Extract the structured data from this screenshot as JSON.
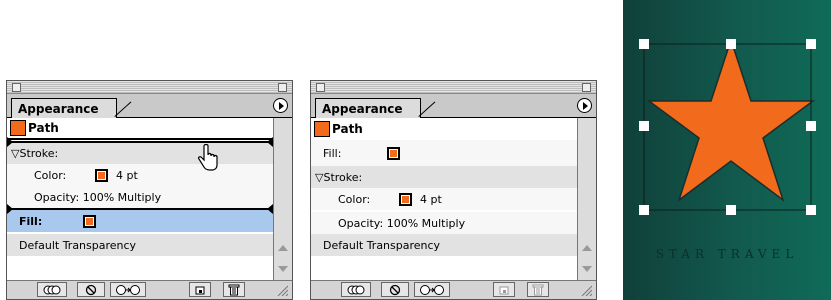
{
  "panels": [
    {
      "tab": "Appearance",
      "rows": {
        "path": "Path",
        "stroke": "▽Stroke:",
        "color_label": "Color:",
        "color_weight": "4 pt",
        "opacity": "Opacity: 100% Multiply",
        "fill": "Fill:",
        "default_transparency": "Default Transparency"
      }
    },
    {
      "tab": "Appearance",
      "rows": {
        "path": "Path",
        "fill": "Fill:",
        "stroke": "▽Stroke:",
        "color_label": "Color:",
        "color_weight": "4 pt",
        "opacity": "Opacity: 100% Multiply",
        "default_transparency": "Default Transparency"
      }
    }
  ],
  "artwork": {
    "caption": "STAR TRAVEL",
    "star_color": "#f26b1d",
    "background_color": "#125a4e"
  },
  "icons": [
    "panel-menu-icon",
    "hand-cursor-icon",
    "new-art-basic-appearance-icon",
    "clear-appearance-icon",
    "reduce-to-basic-appearance-icon",
    "duplicate-item-icon",
    "trash-icon",
    "resize-grip-icon"
  ]
}
